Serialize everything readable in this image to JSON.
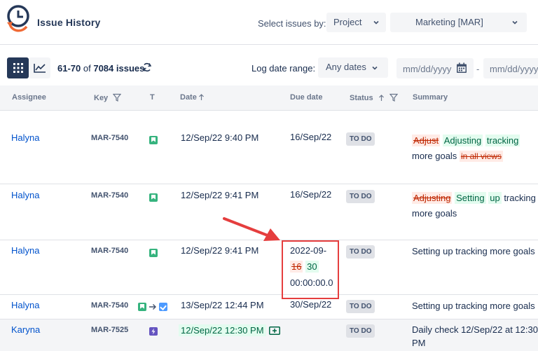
{
  "header": {
    "title": "Issue History",
    "select_label": "Select issues by:",
    "select_by": "Project",
    "project": "Marketing [MAR]"
  },
  "toolbar": {
    "range": "61-70",
    "of": "of",
    "total": "7084 issues",
    "log_label": "Log date range:",
    "date_range": "Any dates",
    "date_from_placeholder": "mm/dd/yyyy",
    "dash": "-",
    "date_to_placeholder": "mm/dd/yyyy"
  },
  "columns": {
    "assignee": "Assignee",
    "key": "Key",
    "type": "T",
    "date": "Date",
    "due": "Due date",
    "status": "Status",
    "summary": "Summary"
  },
  "rows": [
    {
      "assignee": "Halyna",
      "key": "MAR-7540",
      "date": "12/Sep/22 9:40 PM",
      "due": "16/Sep/22",
      "status": "TO DO",
      "sum_del_1": "Adjust",
      "sum_ins_1": "Adjusting",
      "sum_ins_2": "tracking",
      "sum_text": "more goals",
      "sum_del_2": "in all views"
    },
    {
      "assignee": "Halyna",
      "key": "MAR-7540",
      "date": "12/Sep/22 9:41 PM",
      "due": "16/Sep/22",
      "status": "TO DO",
      "sum_del_1": "Adjusting",
      "sum_ins_1": "Setting",
      "sum_ins_2": "up",
      "sum_text": "tracking more goals"
    },
    {
      "assignee": "Halyna",
      "key": "MAR-7540",
      "date": "12/Sep/22 9:41 PM",
      "due_prefix": "2022-09-",
      "due_old": "16",
      "due_new": "30",
      "due_time": "00:00:00.0",
      "status": "TO DO",
      "summary": "Setting up tracking more goals"
    },
    {
      "assignee": "Halyna",
      "key": "MAR-7540",
      "date": "13/Sep/22 12:44 PM",
      "due": "30/Sep/22",
      "status": "TO DO",
      "summary": "Setting up tracking more goals"
    },
    {
      "assignee": "Karyna",
      "key": "MAR-7525",
      "date": "12/Sep/22 12:30 PM",
      "due": "",
      "status": "TO DO",
      "summary_line1": "Daily check 12/Sep/22 at 12:30",
      "summary_line2": "PM"
    }
  ]
}
